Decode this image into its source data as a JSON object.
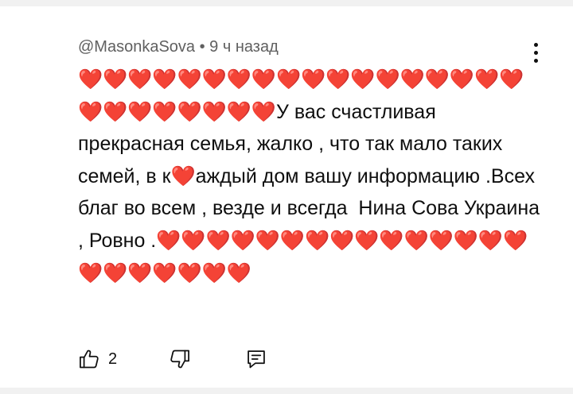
{
  "comment": {
    "author": "@MasonkaSova",
    "separator": " • ",
    "time_ago": "9 ч назад",
    "text": "❤️❤️❤️❤️❤️❤️❤️❤️❤️❤️❤️❤️❤️❤️❤️❤️❤️❤️❤️❤️❤️❤️❤️❤️❤️❤️У вас счастливая прекрасная семья, жалко , что так мало таких семей, в к❤️аждый дом вашу информацию .Всех благ во всем , везде и всегда  Нина Сова Украина , Ровно .❤️❤️❤️❤️❤️❤️❤️❤️❤️❤️❤️❤️❤️❤️❤️❤️❤️❤️❤️❤️❤️❤️"
  },
  "actions": {
    "like_count": "2"
  },
  "icons": {
    "like": "thumbs-up-icon",
    "dislike": "thumbs-down-icon",
    "reply": "reply-comment-icon",
    "menu": "more-vertical-icon"
  }
}
